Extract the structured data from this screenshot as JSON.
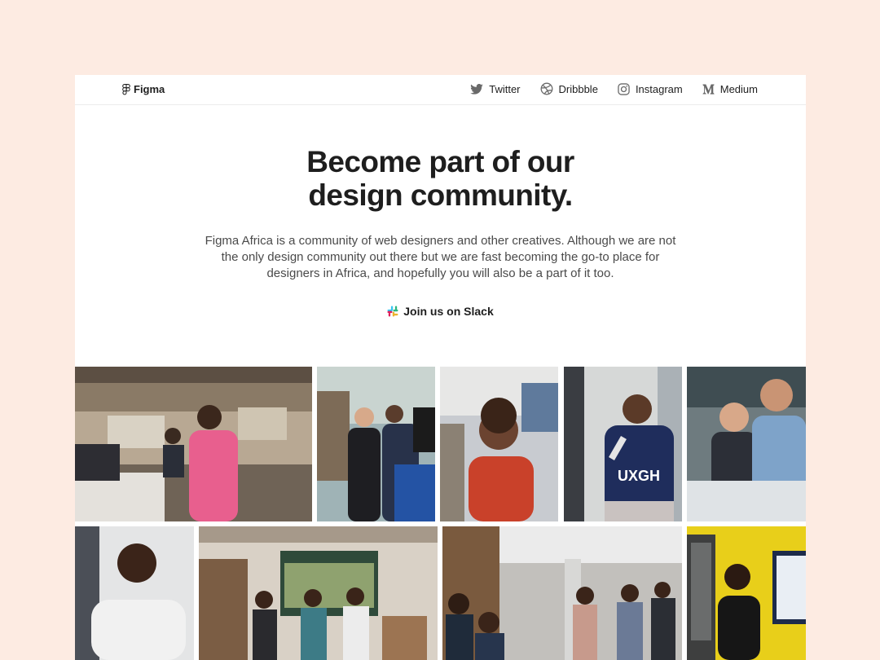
{
  "nav": {
    "brand": "Figma",
    "links": [
      {
        "label": "Twitter",
        "icon": "twitter-icon"
      },
      {
        "label": "Dribbble",
        "icon": "dribbble-icon"
      },
      {
        "label": "Instagram",
        "icon": "instagram-icon"
      },
      {
        "label": "Medium",
        "icon": "medium-icon"
      }
    ]
  },
  "hero": {
    "headline_line1": "Become part of our",
    "headline_line2": "design community.",
    "description": "Figma Africa is a community of web designers and other creatives. Although we are not the only design community out there but we are fast becoming the go-to place for designers in Africa, and hopefully you will also be a part of it too.",
    "cta_label": "Join us on Slack",
    "cta_icon": "slack-icon"
  },
  "gallery": {
    "photos": [
      {
        "name": "photo-workshop-room",
        "shirt_label": ""
      },
      {
        "name": "photo-group-hands-raised",
        "shirt_label": ""
      },
      {
        "name": "photo-woman-smiling",
        "shirt_label": ""
      },
      {
        "name": "photo-man-with-microphone",
        "shirt_label": "UXGH"
      },
      {
        "name": "photo-two-women-at-table",
        "shirt_label": ""
      },
      {
        "name": "photo-man-portrait",
        "shirt_label": ""
      },
      {
        "name": "photo-group-presentation",
        "shirt_label": ""
      },
      {
        "name": "photo-seated-audience",
        "shirt_label": ""
      },
      {
        "name": "photo-woman-yellow-wall",
        "shirt_label": ""
      }
    ]
  },
  "colors": {
    "page_background": "#fdebe2",
    "card_background": "#ffffff",
    "text_primary": "#1e1e1e",
    "text_secondary": "#4a4a4a"
  }
}
